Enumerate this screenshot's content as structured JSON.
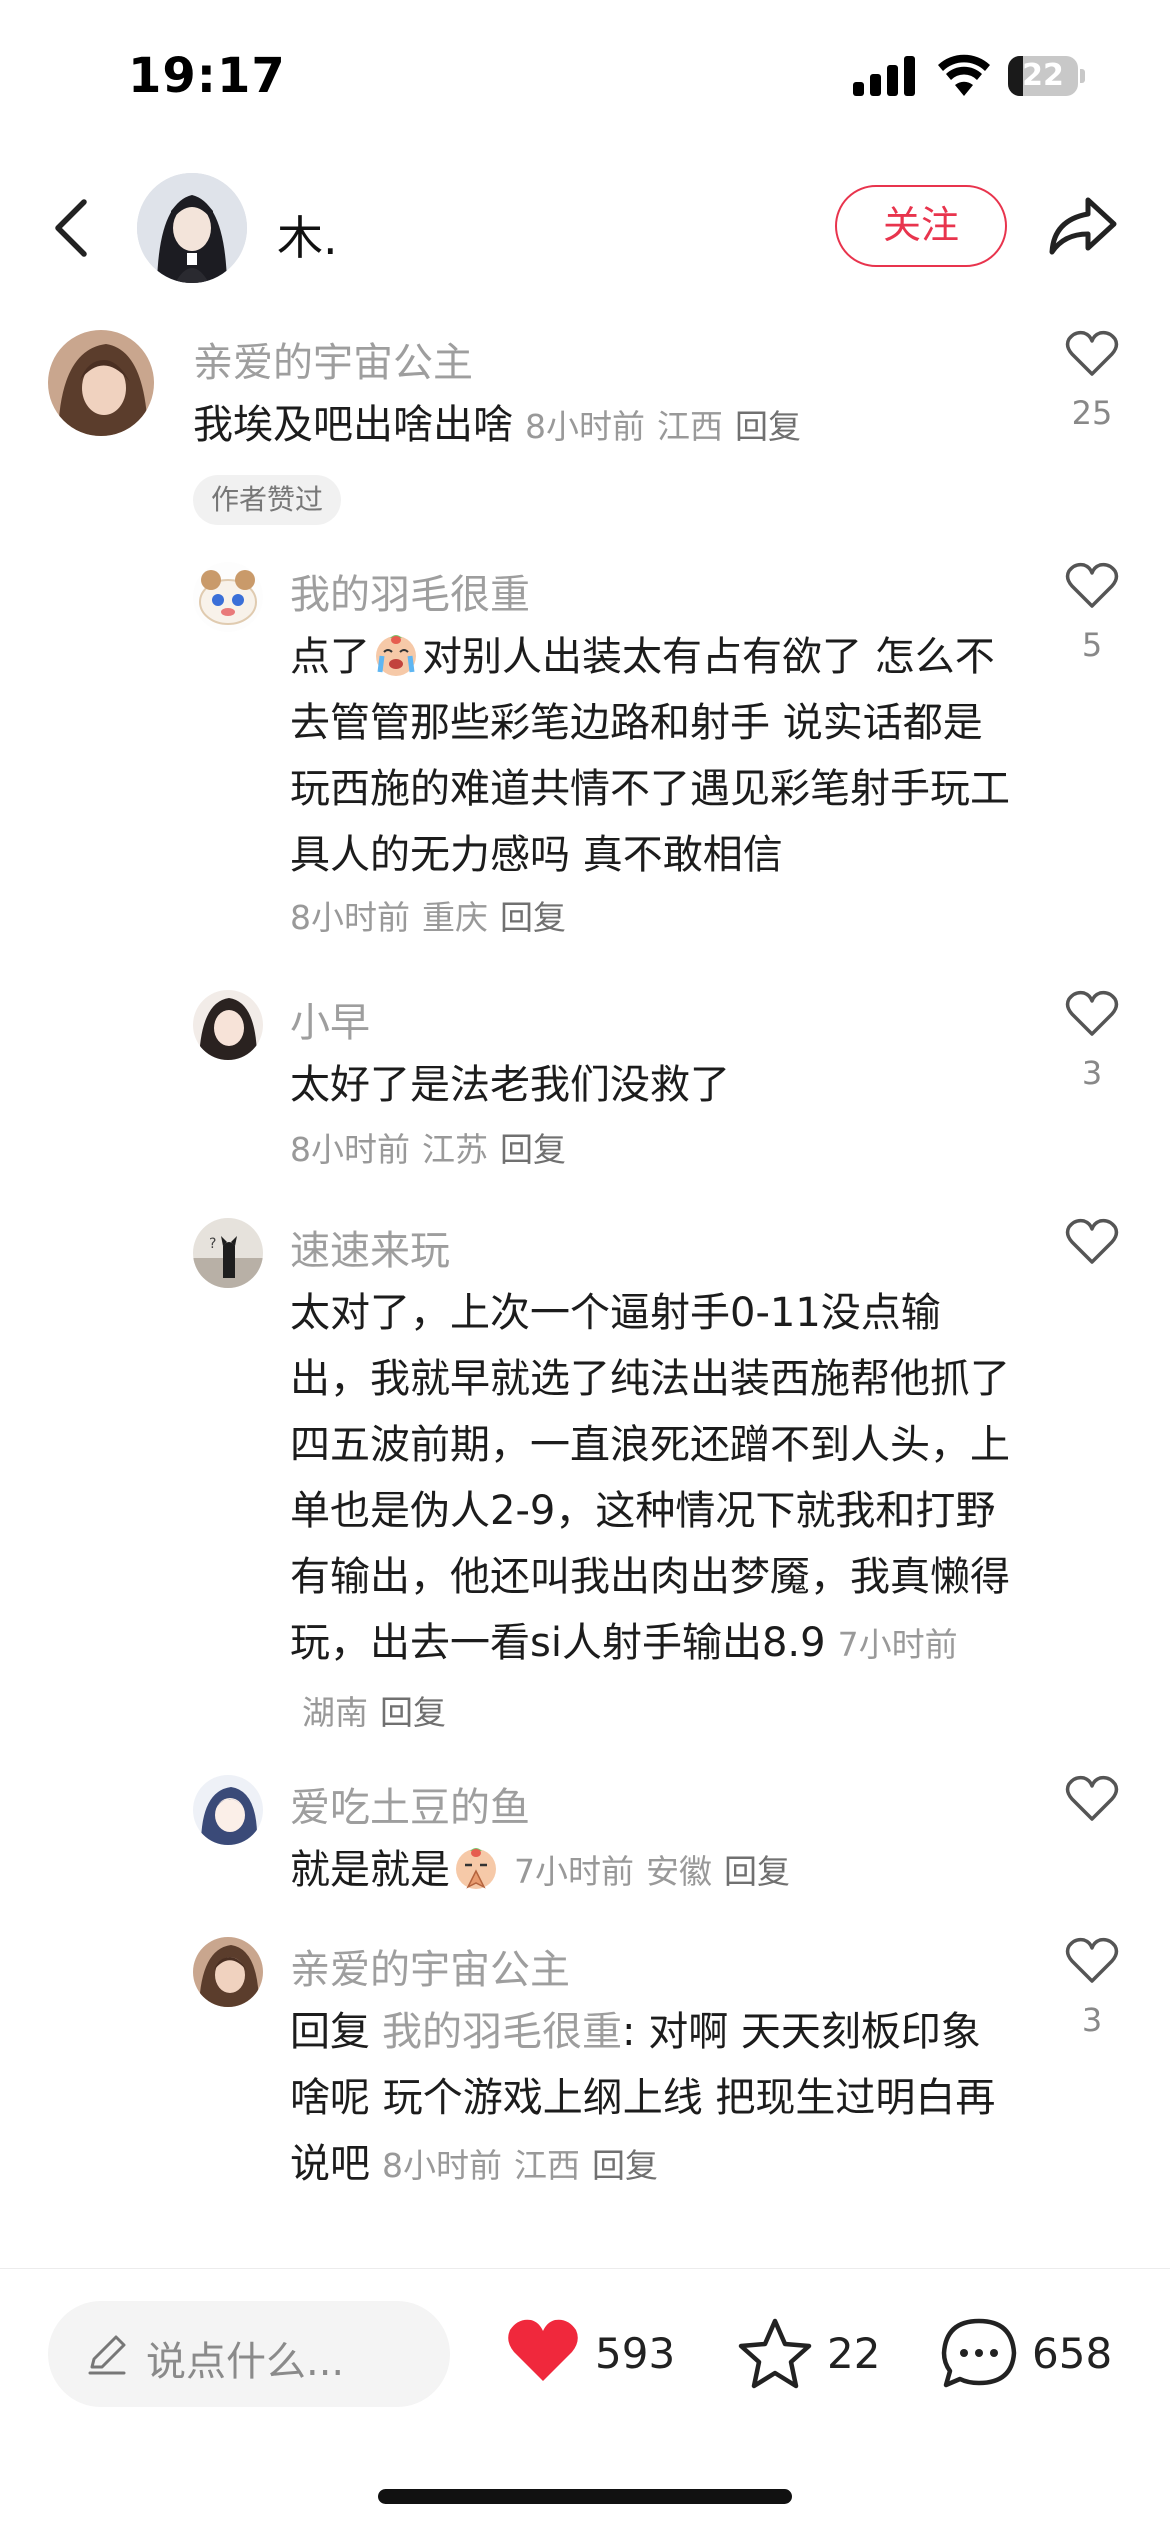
{
  "status_bar": {
    "time": "19:17",
    "battery": "22",
    "battery_level": 0.22
  },
  "header": {
    "username": "木.",
    "follow_label": "关注"
  },
  "comments": [
    {
      "username": "亲爱的宇宙公主",
      "text": "我埃及吧出啥出啥",
      "time": "8小时前",
      "location": "江西",
      "reply_label": "回复",
      "badge": "作者赞过",
      "likes": "25"
    },
    {
      "username": "我的羽毛很重",
      "text_before": "点了",
      "text_after": "对别人出装太有占有欲了 怎么不去管管那些彩笔边路和射手 说实话都是玩西施的难道共情不了遇见彩笔射手玩工具人的无力感吗 真不敢相信",
      "time": "8小时前",
      "location": "重庆",
      "reply_label": "回复",
      "likes": "5"
    },
    {
      "username": "小早",
      "text": "太好了是法老我们没救了",
      "time": "8小时前",
      "location": "江苏",
      "reply_label": "回复",
      "likes": "3"
    },
    {
      "username": "速速来玩",
      "text": "太对了，上次一个逼射手0-11没点输出，我就早就选了纯法出装西施帮他抓了四五波前期，一直浪死还蹭不到人头，上单也是伪人2-9，这种情况下就我和打野有输出，他还叫我出肉出梦魇，我真懒得玩，出去一看si人射手输出8.9",
      "time": "7小时前",
      "location": "湖南",
      "reply_label": "回复",
      "likes": ""
    },
    {
      "username": "爱吃土豆的鱼",
      "text": "就是就是",
      "time": "7小时前",
      "location": "安徽",
      "reply_label": "回复",
      "likes": ""
    },
    {
      "username": "亲爱的宇宙公主",
      "reply_prefix": "回复",
      "reply_to": "我的羽毛很重",
      "text": ": 对啊 天天刻板印象啥呢 玩个游戏上纲上线 把现生过明白再说吧",
      "time": "8小时前",
      "location": "江西",
      "reply_label": "回复",
      "likes": "3"
    }
  ],
  "bottom_bar": {
    "input_placeholder": "说点什么...",
    "likes": "593",
    "favorites": "22",
    "comments": "658"
  },
  "colors": {
    "accent": "#e8344d",
    "muted": "#9e9e9e",
    "heart_filled": "#f0283c"
  }
}
